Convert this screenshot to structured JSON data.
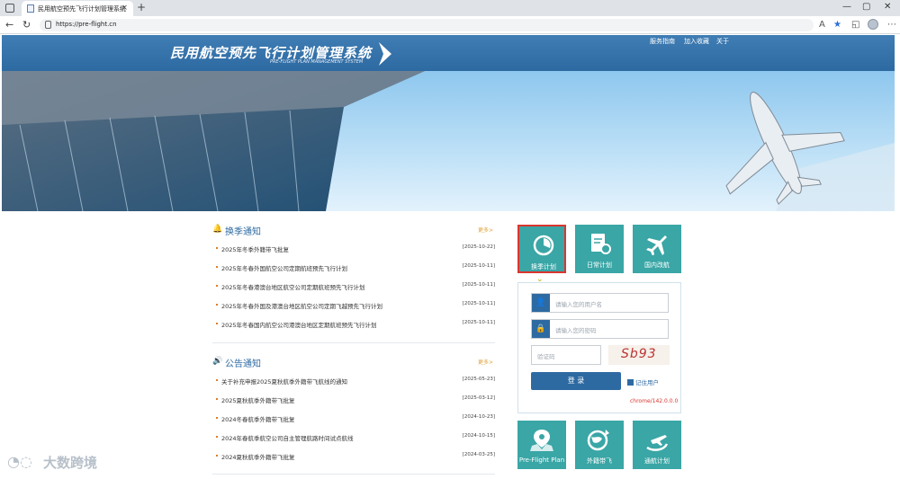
{
  "browser": {
    "tab_title": "民用航空预先飞行计划管理系统",
    "tab_close": "×",
    "new_tab": "+",
    "url": "https://pre-flight.cn",
    "back": "←",
    "refresh": "↻",
    "min": "—",
    "max": "▢",
    "close": "✕"
  },
  "site": {
    "title": "民用航空预先飞行计划管理系统",
    "subtitle": "PRE-FLIGHT PLAN MANAGEMENT SYSTEM",
    "links": [
      "服务指南",
      "加入收藏",
      "关于"
    ]
  },
  "season": {
    "heading": "换季通知",
    "more": "更多>",
    "items": [
      {
        "text": "2025年冬季外籍带飞批复",
        "date": "[2025-10-22]"
      },
      {
        "text": "2025年冬春外国航空公司定期航班预先飞行计划",
        "date": "[2025-10-11]"
      },
      {
        "text": "2025年冬春港澳台地区航空公司定期航班预先飞行计划",
        "date": "[2025-10-11]"
      },
      {
        "text": "2025年冬春外国及港澳台地区航空公司定期飞越预先飞行计划",
        "date": "[2025-10-11]"
      },
      {
        "text": "2025年冬春国内航空公司港澳台地区定期航班预先飞行计划",
        "date": "[2025-10-11]"
      }
    ]
  },
  "notice": {
    "heading": "公告通知",
    "more": "更多>",
    "items": [
      {
        "text": "关于补充申报2025夏秋航季外籍带飞航线的通知",
        "date": "[2025-05-23]"
      },
      {
        "text": "2025夏秋航季外籍带飞批复",
        "date": "[2025-03-12]"
      },
      {
        "text": "2024冬春航季外籍带飞批复",
        "date": "[2024-10-23]"
      },
      {
        "text": "2024年春航季航空公司自主管理航路时间试点航线",
        "date": "[2024-10-15]"
      },
      {
        "text": "2024夏秋航季外籍带飞批复",
        "date": "[2024-03-25]"
      }
    ]
  },
  "tiles_top": [
    {
      "label": "换季计划",
      "icon": "pie-chart-icon",
      "active": true
    },
    {
      "label": "日常计划",
      "icon": "document-clock-icon",
      "active": false
    },
    {
      "label": "国内改航",
      "icon": "airplane-icon",
      "active": false
    }
  ],
  "login": {
    "username_ph": "请输入您的用户名",
    "password_ph": "请输入您的密码",
    "captcha_ph": "验证码",
    "captcha_text": "Sb93",
    "login_label": "登 录",
    "remember_label": "记住用户",
    "browser_version": "chrome/142.0.0.0"
  },
  "tiles_bottom": [
    {
      "label": "Pre-Flight Plan",
      "icon": "map-pin-icon"
    },
    {
      "label": "外籍带飞",
      "icon": "globe-plane-icon"
    },
    {
      "label": "通航计划",
      "icon": "plane-takeoff-icon"
    }
  ],
  "watermark": "大数跨境",
  "colors": {
    "header": "#2e6aa2",
    "tile": "#3aa6a6",
    "accent": "#d9362f",
    "more": "#e0a23a"
  }
}
